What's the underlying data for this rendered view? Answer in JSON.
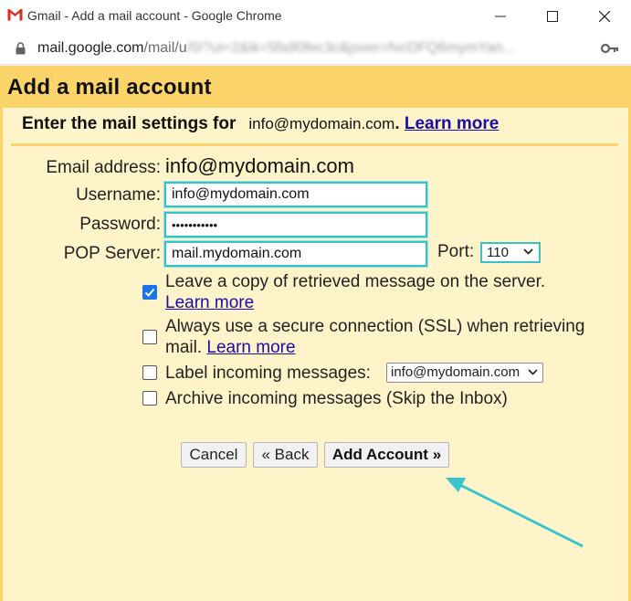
{
  "window": {
    "title": "Gmail - Add a mail account - Google Chrome",
    "minimize_icon": "minimize-icon",
    "maximize_icon": "maximize-icon",
    "close_icon": "close-icon"
  },
  "addressbar": {
    "host": "mail.google.com",
    "path": "/mail/u",
    "obscured": "/0/?ui=2&ik=5fa90fec3c&jsver=fvcDFQ6mymYan..."
  },
  "dialog": {
    "title": "Add a mail account",
    "subheader_label": "Enter the mail settings for",
    "subheader_email": "info@mydomain.com",
    "learn_more": "Learn more"
  },
  "form": {
    "email_label": "Email address:",
    "email_value": "info@mydomain.com",
    "username_label": "Username:",
    "username_value": "info@mydomain.com",
    "password_label": "Password:",
    "password_value": "•••••••••••",
    "pop_label": "POP Server:",
    "pop_value": "mail.mydomain.com",
    "port_label": "Port:",
    "port_value": "110"
  },
  "options": {
    "leave_copy": {
      "line1": "Leave a copy of retrieved message on the server.",
      "link": "Learn more",
      "checked": true
    },
    "ssl": {
      "line1": "Always use a secure connection (SSL) when retrieving",
      "line2": "mail.",
      "link": "Learn more",
      "checked": false
    },
    "label_incoming": {
      "text": "Label incoming messages:",
      "select_value": "info@mydomain.com",
      "checked": false
    },
    "archive": {
      "text": "Archive incoming messages (Skip the Inbox)",
      "checked": false
    }
  },
  "buttons": {
    "cancel": "Cancel",
    "back": "« Back",
    "add_account": "Add Account »"
  },
  "colors": {
    "header_bg": "#fcd56a",
    "body_bg": "#fff4c9",
    "highlight": "#34c3c9",
    "link": "#1a0dab"
  }
}
